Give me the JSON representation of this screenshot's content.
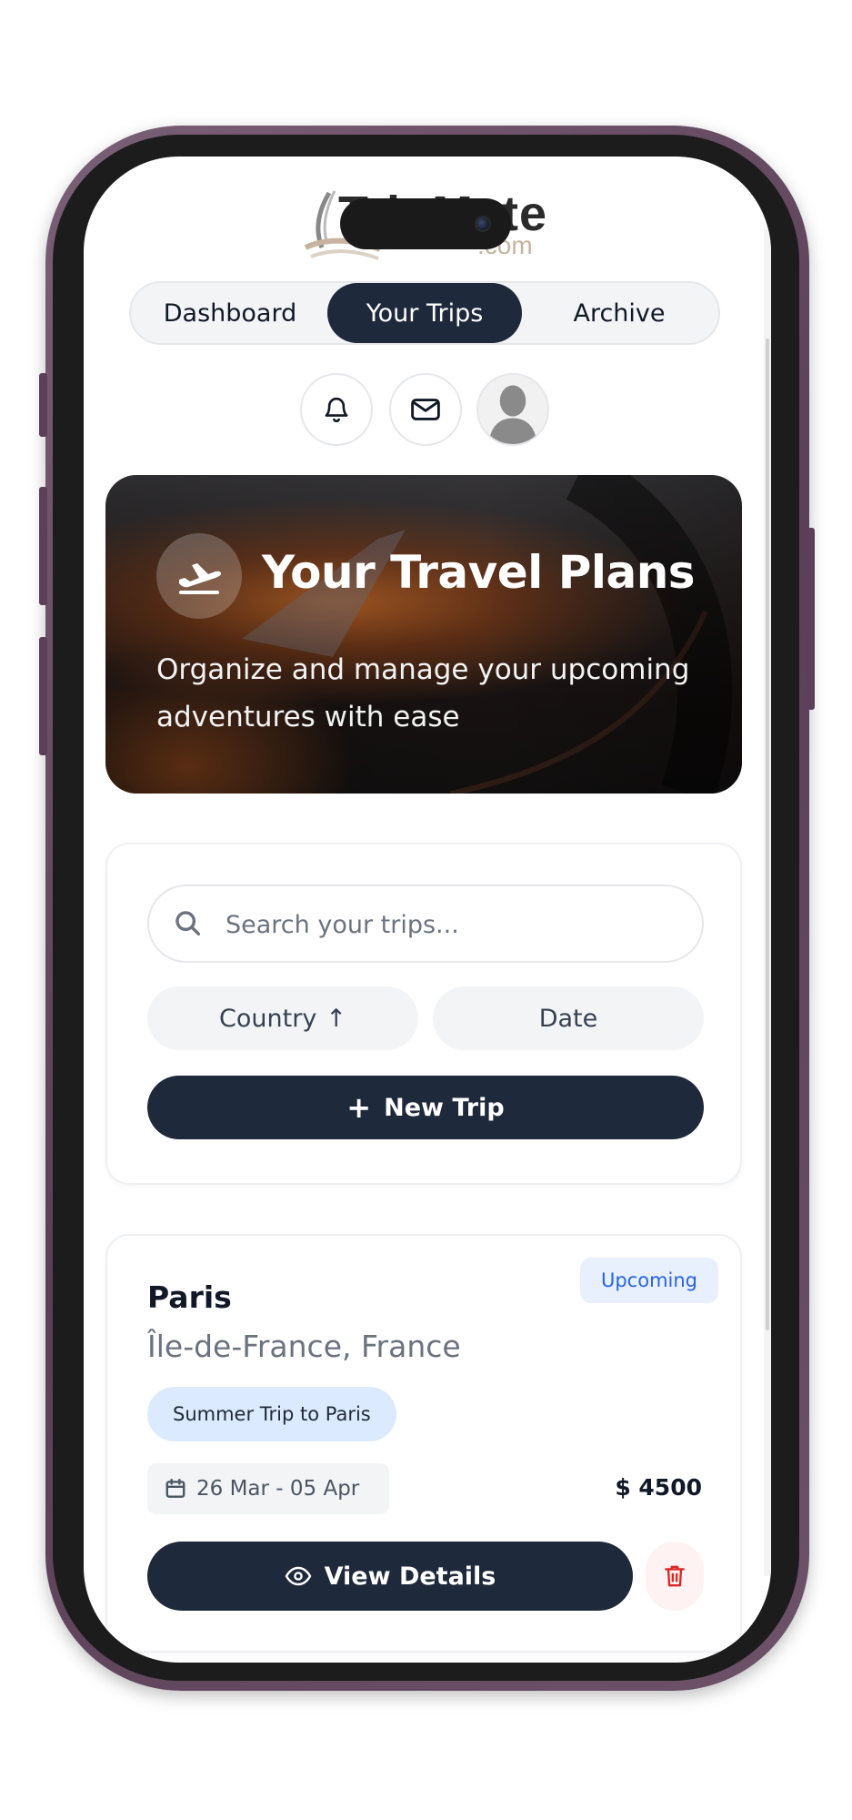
{
  "app": {
    "logo_text": "TripMate",
    "logo_suffix": ".com"
  },
  "tabs": [
    {
      "label": "Dashboard",
      "active": false
    },
    {
      "label": "Your Trips",
      "active": true
    },
    {
      "label": "Archive",
      "active": false
    }
  ],
  "header_icons": [
    "bell-icon",
    "mail-icon",
    "avatar"
  ],
  "hero": {
    "icon": "plane-departure-icon",
    "title": "Your Travel Plans",
    "subtitle": "Organize and manage your upcoming adventures with ease"
  },
  "search": {
    "placeholder": "Search your trips...",
    "value": ""
  },
  "sort": {
    "country_label": "Country",
    "country_direction": "↑",
    "date_label": "Date"
  },
  "new_trip": {
    "icon": "+",
    "label": "New Trip"
  },
  "trips": [
    {
      "city": "Paris",
      "status": "Upcoming",
      "region": "Île-de-France, France",
      "tag": "Summer Trip to Paris",
      "dates": "26 Mar - 05 Apr",
      "price": "$ 4500",
      "view_label": "View Details"
    }
  ],
  "colors": {
    "primary_dark": "#1e293b",
    "status_blue": "#2563eb",
    "tag_bg": "#dbeafe",
    "danger": "#dc2626",
    "phone_frame": "#5a3f57"
  }
}
